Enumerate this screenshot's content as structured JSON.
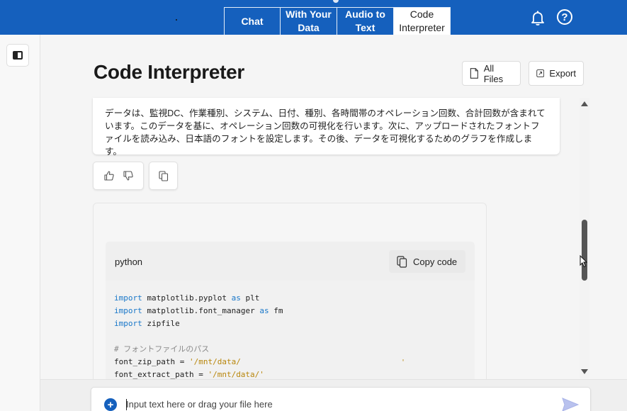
{
  "nav": {
    "tabs": [
      {
        "label": "Chat"
      },
      {
        "label": "With Your Data"
      },
      {
        "label": "Audio to Text"
      },
      {
        "label": "Code Interpreter"
      }
    ],
    "active_tab": "Code Interpreter",
    "icons": [
      "bell-icon",
      "help-icon"
    ]
  },
  "header": {
    "title": "Code Interpreter",
    "all_files_label": "All Files",
    "export_label": "Export"
  },
  "message": {
    "text": "データは、監視DC、作業種別、システム、日付、種別、各時間帯のオペレーション回数、合計回数が含まれています。このデータを基に、オペレーション回数の可視化を行います。次に、アップロードされたフォントファイルを読み込み、日本語のフォントを設定します。その後、データを可視化するためのグラフを作成します。"
  },
  "code_block": {
    "language": "python",
    "copy_label": "Copy code",
    "lines": [
      [
        {
          "t": "import",
          "c": "kw"
        },
        {
          "t": " matplotlib.pyplot ",
          "c": ""
        },
        {
          "t": "as",
          "c": "kw"
        },
        {
          "t": " plt",
          "c": ""
        }
      ],
      [
        {
          "t": "import",
          "c": "kw"
        },
        {
          "t": " matplotlib.font_manager ",
          "c": ""
        },
        {
          "t": "as",
          "c": "kw"
        },
        {
          "t": " fm",
          "c": ""
        }
      ],
      [
        {
          "t": "import",
          "c": "kw"
        },
        {
          "t": " zipfile",
          "c": ""
        }
      ],
      [],
      [
        {
          "t": "# フォントファイルのパス",
          "c": "cm"
        }
      ],
      [
        {
          "t": "font_zip_path = ",
          "c": ""
        },
        {
          "t": "'/mnt/data/",
          "c": "str"
        }
      ],
      [
        {
          "t": "font_extract_path = ",
          "c": ""
        },
        {
          "t": "'/mnt/data/'",
          "c": "str"
        }
      ]
    ],
    "stray_mark": "'"
  },
  "input": {
    "placeholder": "Input text here or drag your file here"
  },
  "colors": {
    "brand": "#1560bd",
    "keyword": "#1877c9",
    "string": "#b8860b"
  }
}
